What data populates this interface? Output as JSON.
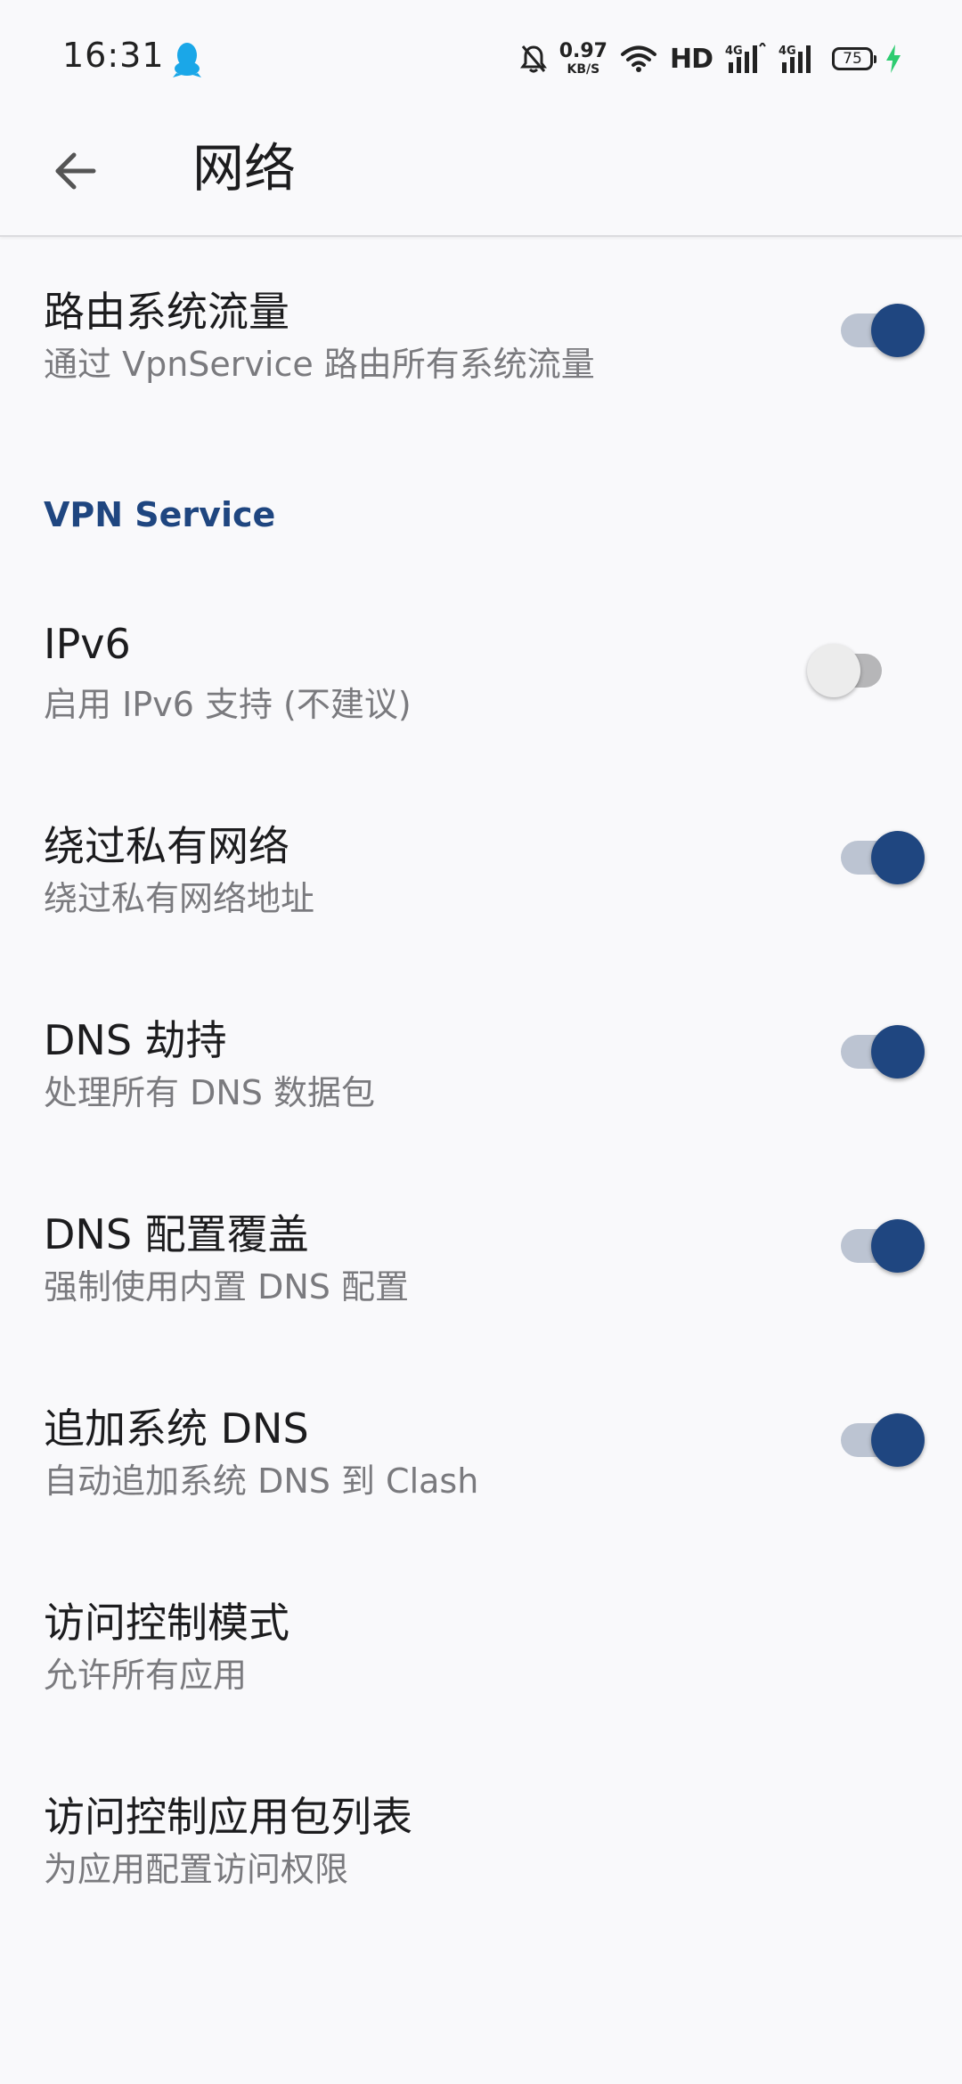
{
  "status_bar": {
    "time": "16:31",
    "net_speed_value": "0.97",
    "net_speed_unit": "KB/S",
    "hd_label": "HD",
    "battery_level": "75",
    "colors": {
      "qq": "#1aa7e8",
      "charging": "#2ecc71"
    },
    "icons": [
      "qq-icon",
      "bell-mute-icon",
      "wifi-icon",
      "signal-4g-icon",
      "signal-4g-icon-2",
      "battery-icon",
      "charging-bolt-icon"
    ]
  },
  "app_bar": {
    "title": "网络",
    "back_icon": "arrow-back-icon"
  },
  "preferences": {
    "route_system": {
      "title": "路由系统流量",
      "summary": "通过 VpnService 路由所有系统流量",
      "checked": true
    },
    "section_vpn": {
      "title": "VPN Service"
    },
    "ipv6": {
      "title": "IPv6",
      "summary": "启用 IPv6 支持 (不建议)",
      "checked": false
    },
    "bypass_private": {
      "title": "绕过私有网络",
      "summary": "绕过私有网络地址",
      "checked": true
    },
    "dns_hijack": {
      "title": "DNS 劫持",
      "summary": "处理所有 DNS 数据包",
      "checked": true
    },
    "dns_override": {
      "title": "DNS 配置覆盖",
      "summary": "强制使用内置 DNS 配置",
      "checked": true
    },
    "append_dns": {
      "title": "追加系统 DNS",
      "summary": "自动追加系统 DNS 到 Clash",
      "checked": true
    },
    "access_mode": {
      "title": "访问控制模式",
      "summary": "允许所有应用"
    },
    "access_packages": {
      "title": "访问控制应用包列表",
      "summary": "为应用配置访问权限"
    }
  },
  "colors": {
    "accent": "#1f4680",
    "switch_track_on": "#bcc4d2",
    "switch_track_off": "#b6b6b8",
    "background": "#f9f9fb"
  }
}
